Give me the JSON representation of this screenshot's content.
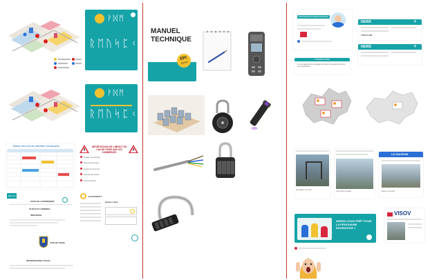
{
  "col1": {
    "runes_title_1": "ᚹᛞᛗ",
    "runes_sub_1": "ᚱᛖᚢᛋᛈᚲ",
    "runes_title_2": "ᚹᛞᛗ",
    "runes_sub_2": "ᚱᛖᚢᛋᛈᚲ",
    "table_title": "Tableau des croix aux identités commerçants",
    "impact_title": "IMPORTATIONS DE L'IMPACT EN CAS DE CRISE SUR LES COMMERCES",
    "impact_items": [
      "Activité commerciale",
      "Approvisionnement",
      "Emploi et personnel",
      "Sécurité des locaux",
      "Communication"
    ],
    "melun_label": "MELUN",
    "steps_title": "SUIVI DE L'ÉVÈNEMENT",
    "address": "23 RUE DU GÉNÉRAL",
    "info_label": "INDIVIDUEL",
    "city_label": "AVIS DE CRISE",
    "footer_label": "INFORMATIONS UTILES",
    "electricity_label": "ELECTRICITY",
    "contacts_title": "Numéros utiles"
  },
  "col2": {
    "manual_title_line1": "MANUEL",
    "manual_title_line2": "TECHNIQUE",
    "epi_badge_line1": "EPI",
    "epi_badge_line2": "TERRE"
  },
  "col3": {
    "profile_label": "PROFESSION ARRANGEABLE",
    "comment_label": "COMMENTAIRE",
    "comment_text": "Je vois également et partager les biens compostement liés à une restauration",
    "news_label": "NEWS",
    "news_label_2": "NEWS",
    "ticket_class": "TYPE CLASS",
    "alert_label": "LE DAUPHIN",
    "banner_text": "SERIEZ-VOUS PRÊT POUR LA PROCHAINE INONDATION ?",
    "visov_label": "VISOV",
    "news_cards": [
      "Inondation en cours",
      "Crue dans la vallée",
      "Mise en sécurité"
    ]
  },
  "colors": {
    "teal": "#16a3a8",
    "divider": "#c0392b",
    "yellow": "#f2c12e"
  }
}
